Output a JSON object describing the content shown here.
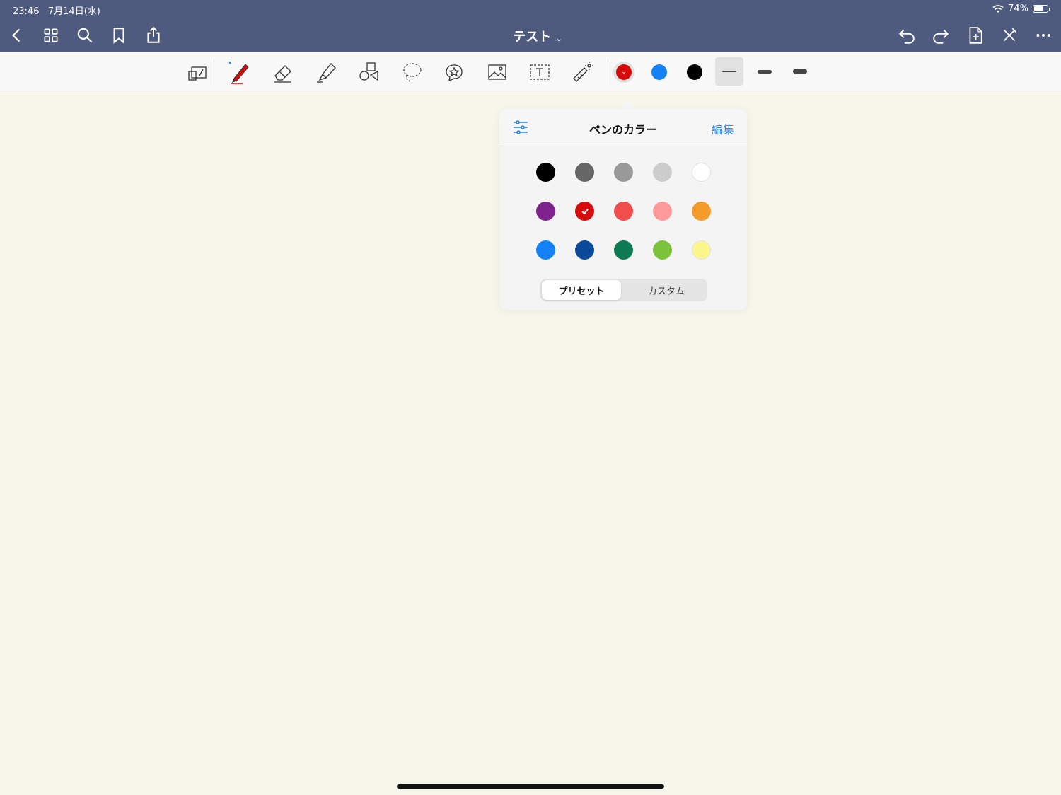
{
  "status_bar": {
    "time": "23:46",
    "date": "7月14日(水)",
    "battery": "74%",
    "battery_level": 0.74
  },
  "nav": {
    "title": "テスト"
  },
  "toolbar": {
    "quick_colors": [
      "#d60c0c",
      "#1481f5",
      "#000000"
    ],
    "selected_color": "#d60c0c"
  },
  "popover": {
    "title": "ペンのカラー",
    "edit_label": "編集",
    "colors": [
      [
        "#000000",
        "#666666",
        "#999999",
        "#cccccc",
        "#ffffff"
      ],
      [
        "#7f248f",
        "#d60c0c",
        "#f24d4d",
        "#ff9a9a",
        "#f59b2b"
      ],
      [
        "#1481f5",
        "#0b4a9a",
        "#0e7a52",
        "#7cc23b",
        "#fbf78b"
      ]
    ],
    "selected_color": "#d60c0c",
    "segments": [
      "プリセット",
      "カスタム"
    ],
    "active_segment": "プリセット"
  }
}
